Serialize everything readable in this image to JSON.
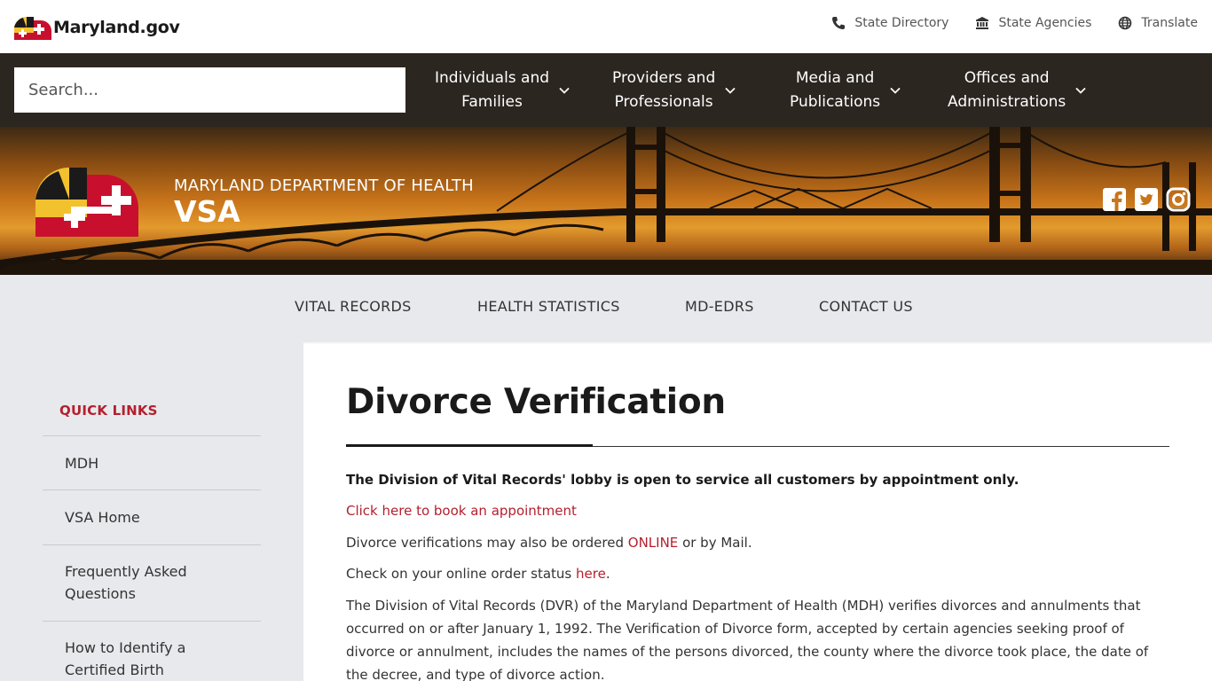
{
  "utility": {
    "logo_text": "Maryland.gov",
    "links": [
      {
        "label": "State Directory",
        "icon": "phone-icon"
      },
      {
        "label": "State Agencies",
        "icon": "building-icon"
      },
      {
        "label": "Translate",
        "icon": "globe-icon"
      }
    ]
  },
  "mainnav": {
    "search_placeholder": "Search...",
    "items": [
      {
        "label": "Individuals and\nFamilies"
      },
      {
        "label": "Providers and\nProfessionals"
      },
      {
        "label": "Media and\nPublications"
      },
      {
        "label": "Offices and\nAdministrations"
      }
    ]
  },
  "banner": {
    "department": "MARYLAND DEPARTMENT OF HEALTH",
    "site_name": "VSA",
    "social": [
      "facebook-icon",
      "twitter-icon",
      "instagram-icon"
    ]
  },
  "subnav": {
    "items": [
      "VITAL RECORDS",
      "HEALTH STATISTICS",
      "MD-EDRS",
      "CONTACT US"
    ]
  },
  "sidebar": {
    "title": "QUICK LINKS",
    "items": [
      "MDH",
      "VSA Home",
      "Frequently Asked Questions",
      "How to Identify a Certified Birth"
    ]
  },
  "content": {
    "title": "Divorce Verification",
    "lobby_notice": "The Division of Vital Records' lobby is open to service all customers by appointment only.",
    "appointment_link": "Click here to book an appointment",
    "order_prefix": "Divorce verifications may also be ordered ",
    "order_link": "ONLINE",
    "order_suffix": " or by Mail.",
    "status_prefix": "Check on your online order status ",
    "status_link": "here",
    "status_suffix": ".",
    "description": "The Division of Vital Records (DVR) of the Maryland Department of Health (MDH) verifies divorces and annulments that occurred on or after January 1, 1992. The Verification of Divorce form, accepted by certain agencies seeking proof of divorce or annulment, includes the names of the persons divorced, the county where the divorce took place, the date of the decree, and type of divorce action."
  },
  "colors": {
    "accent_red": "#b51f2e",
    "nav_dark": "#2b2620",
    "sidebar_gray": "#e7e9ec"
  }
}
